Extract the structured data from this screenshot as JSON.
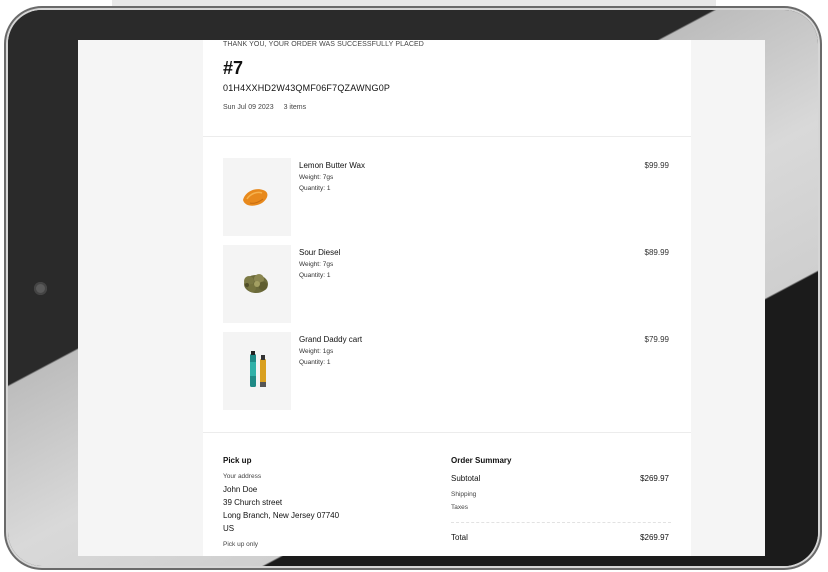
{
  "order": {
    "thanks_message": "THANK YOU, YOUR ORDER WAS SUCCESSFULLY PLACED",
    "number": "#7",
    "id": "01H4XXHD2W43QMF06F7QZAWNG0P",
    "date": "Sun Jul 09 2023",
    "item_count": "3 items"
  },
  "items": [
    {
      "title": "Lemon Butter Wax",
      "weight": "Weight: 7gs",
      "quantity": "Quantity: 1",
      "price": "$99.99",
      "icon": "wax-icon"
    },
    {
      "title": "Sour Diesel",
      "weight": "Weight: 7gs",
      "quantity": "Quantity: 1",
      "price": "$89.99",
      "icon": "flower-bud-icon"
    },
    {
      "title": "Grand Daddy cart",
      "weight": "Weight: 1gs",
      "quantity": "Quantity: 1",
      "price": "$79.99",
      "icon": "vape-cart-icon"
    }
  ],
  "pickup": {
    "title": "Pick up",
    "address_label": "Your address",
    "name": "John Doe",
    "street": "39 Church street",
    "city": "Long Branch, New Jersey 07740",
    "country": "US",
    "method": "Pick up only"
  },
  "summary": {
    "title": "Order Summary",
    "subtotal_label": "Subtotal",
    "subtotal_value": "$269.97",
    "shipping_label": "Shipping",
    "taxes_label": "Taxes",
    "total_label": "Total",
    "total_value": "$269.97"
  },
  "colors": {
    "device_bezel": "#1d1d1d",
    "accent_line": "#41c46b",
    "wax": "#e8891c",
    "cart_label": "#1f8a86"
  }
}
